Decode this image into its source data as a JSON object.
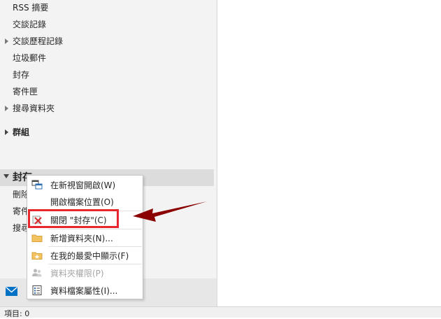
{
  "folders": [
    {
      "label": "RSS 摘要"
    },
    {
      "label": "交談記錄"
    },
    {
      "label": "交談歷程記錄"
    },
    {
      "label": "垃圾郵件"
    },
    {
      "label": "封存"
    },
    {
      "label": "寄件匣"
    },
    {
      "label": "搜尋資料夾"
    }
  ],
  "groups": {
    "label": "群組"
  },
  "archive_group": {
    "label": "封存",
    "children": [
      "刪除",
      "寄件",
      "搜尋"
    ]
  },
  "context_menu": {
    "items": [
      {
        "label": "在新視窗開啟(W)",
        "icon": "new-window-icon",
        "enabled": true
      },
      {
        "label": "開啟檔案位置(O)",
        "icon": "",
        "enabled": true
      },
      {
        "label": "關閉 \"封存\"(C)",
        "icon": "close-red-x-icon",
        "enabled": true
      },
      {
        "label": "新增資料夾(N)...",
        "icon": "folder-icon",
        "enabled": true
      },
      {
        "label": "在我的最愛中顯示(F)",
        "icon": "favorite-folder-icon",
        "enabled": true
      },
      {
        "label": "資料夾權限(P)",
        "icon": "permissions-icon",
        "enabled": false
      },
      {
        "label": "資料檔案屬性(I)...",
        "icon": "properties-icon",
        "enabled": true
      }
    ]
  },
  "status_bar": {
    "label": "項目: 0"
  },
  "colors": {
    "highlight": "#e8262d",
    "arrow": "#8b0000",
    "accent": "#0072c6"
  }
}
